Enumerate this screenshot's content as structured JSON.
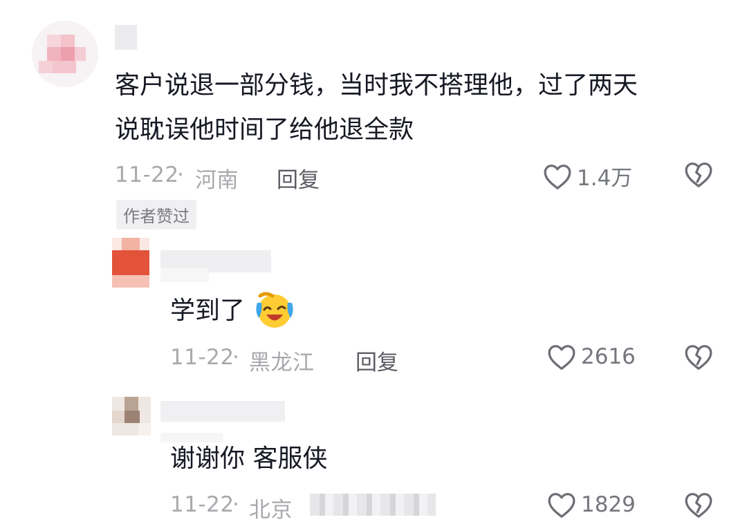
{
  "comments": [
    {
      "text_line1": "客户说退一部分钱，当时我不搭理他，过了两天",
      "text_line2": "说耽误他时间了给他退全款",
      "date": "11-22",
      "location": "河南",
      "reply_label": "回复",
      "likes": "1.4万",
      "badge": "作者赞过"
    },
    {
      "text": "学到了",
      "emoji": "laughing-crying-emoji",
      "date": "11-22",
      "location": "黑龙江",
      "reply_label": "回复",
      "likes": "2616"
    },
    {
      "text": "谢谢你 客服侠",
      "date": "11-22",
      "location": "北京",
      "likes": "1829"
    }
  ],
  "icons": {
    "like": "heart-outline-icon",
    "dislike": "broken-heart-icon"
  },
  "colors": {
    "text": "#161823",
    "meta": "#a8a9ad",
    "reply": "#5b5c63",
    "badge_bg": "#f0f0f2"
  }
}
